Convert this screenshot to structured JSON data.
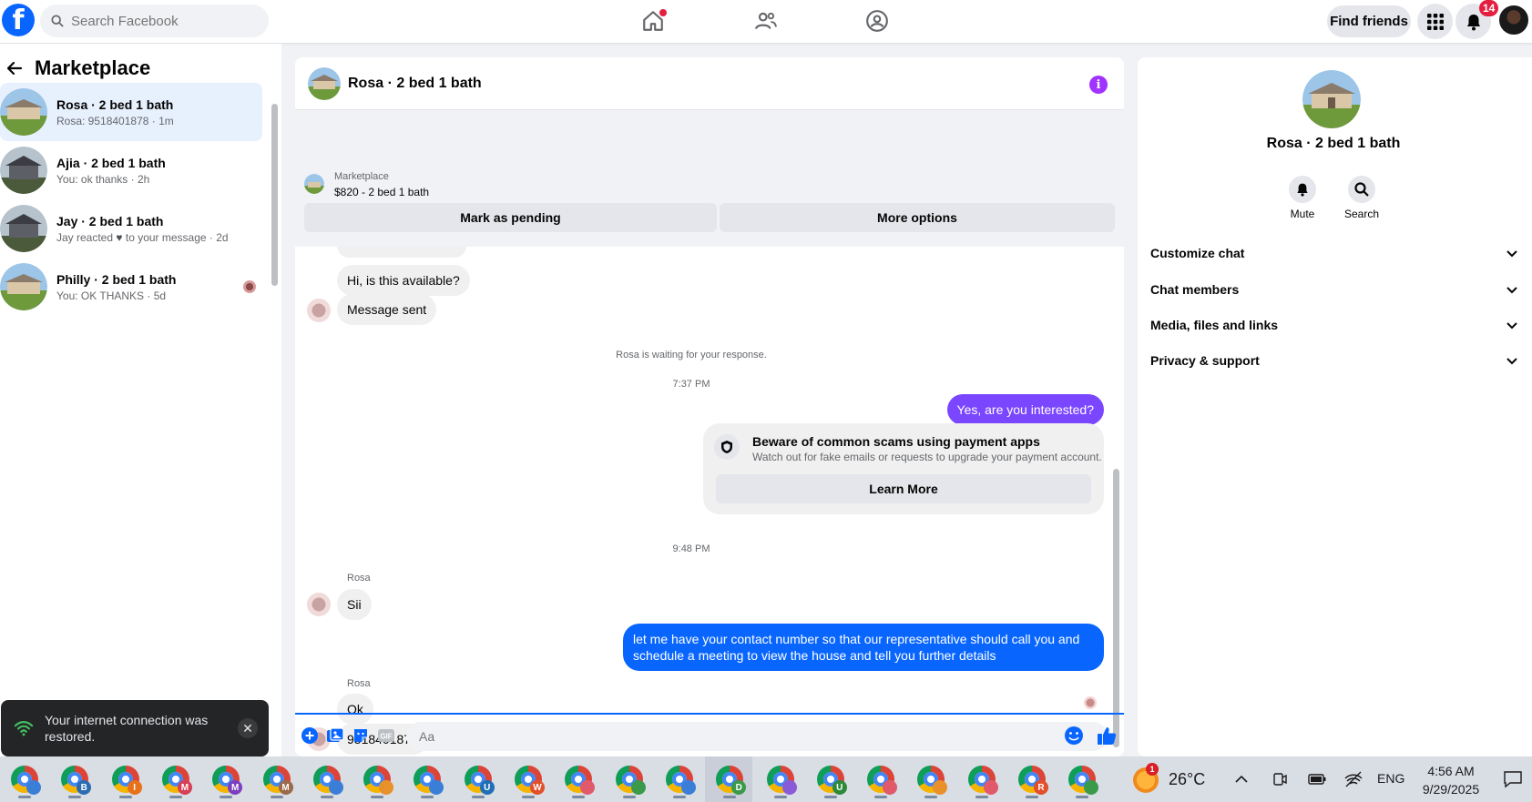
{
  "topbar": {
    "search_placeholder": "Search Facebook",
    "find_friends_label": "Find friends",
    "notification_count": "14"
  },
  "sidebar": {
    "title": "Marketplace",
    "conversations": [
      {
        "name": "Rosa · 2 bed 1 bath",
        "preview": "Rosa: 9518401878 · 1m",
        "active": true
      },
      {
        "name": "Ajia · 2 bed 1 bath",
        "preview": "You: ok thanks · 2h",
        "active": false
      },
      {
        "name": "Jay · 2 bed 1 bath",
        "preview_before": "Jay reacted",
        "preview_after": "to your message · 2d",
        "active": false
      },
      {
        "name": "Philly · 2 bed 1 bath",
        "preview": "You: OK THANKS · 5d",
        "active": false
      }
    ]
  },
  "toast": {
    "message": "Your internet connection was restored."
  },
  "chat": {
    "title": "Rosa · 2 bed 1 bath",
    "listing": {
      "source": "Marketplace",
      "price_title": "$820 - 2 bed 1 bath",
      "mark_pending_label": "Mark as pending",
      "more_options_label": "More options"
    },
    "messages": {
      "m1": "Hi, is this available?",
      "m2": "Message sent",
      "waiting": "Rosa is waiting for your response.",
      "time1": "7:37 PM",
      "out1": "Yes, are you interested?",
      "scam_title": "Beware of common scams using payment apps",
      "scam_desc": "Watch out for fake emails or requests to upgrade your payment account.",
      "scam_button": "Learn More",
      "time2": "9:48 PM",
      "sender1": "Rosa",
      "in1": "Sii",
      "out2": "let me have your contact number so that our representative should call you and schedule a meeting to view the house and tell you further details",
      "sender2": "Rosa",
      "in2": "Ok",
      "in3": "9518401878"
    },
    "composer_placeholder": "Aa"
  },
  "right_panel": {
    "name": "Rosa · 2 bed 1 bath",
    "mute_label": "Mute",
    "search_label": "Search",
    "sections": [
      "Customize chat",
      "Chat members",
      "Media, files and links",
      "Privacy & support"
    ]
  },
  "taskbar": {
    "weather_badge": "1",
    "temperature": "26°C",
    "language": "ENG",
    "time": "4:56 AM",
    "date": "9/29/2025",
    "apps": [
      {
        "letter": ""
      },
      {
        "letter": "B"
      },
      {
        "letter": "I"
      },
      {
        "letter": "M"
      },
      {
        "letter": "M"
      },
      {
        "letter": "M"
      },
      {
        "letter": ""
      },
      {
        "letter": ""
      },
      {
        "letter": ""
      },
      {
        "letter": "U"
      },
      {
        "letter": "W"
      },
      {
        "letter": ""
      },
      {
        "letter": ""
      },
      {
        "letter": ""
      },
      {
        "letter": "D"
      },
      {
        "letter": ""
      },
      {
        "letter": "U"
      },
      {
        "letter": ""
      },
      {
        "letter": ""
      },
      {
        "letter": ""
      },
      {
        "letter": "R"
      },
      {
        "letter": ""
      }
    ]
  },
  "colors": {
    "brand_blue": "#0866ff",
    "outgoing_purple": "#7b46ff",
    "info_purple": "#a033ff",
    "badge_red": "#e41e3f"
  }
}
